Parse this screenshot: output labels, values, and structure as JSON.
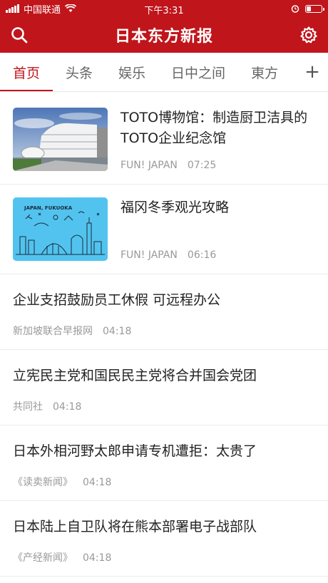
{
  "status": {
    "carrier": "中国联通",
    "time": "下午3:31",
    "battery_level": 0.3
  },
  "header": {
    "title": "日本东方新报",
    "search_icon": "search-icon",
    "settings_icon": "gear-icon"
  },
  "tabs": [
    {
      "label": "首页"
    },
    {
      "label": "头条"
    },
    {
      "label": "娱乐"
    },
    {
      "label": "日中之间"
    },
    {
      "label": "東方"
    }
  ],
  "add_tab_label": "+",
  "feed": [
    {
      "title": "TOTO博物馆：制造厨卫洁具的TOTO企业纪念馆",
      "source": "FUN! JAPAN",
      "time": "07:25"
    },
    {
      "title": "福冈冬季观光攻略",
      "source": "FUN! JAPAN",
      "time": "06:16",
      "thumb_text": "JAPAN, FUKUOKA"
    },
    {
      "title": "企业支招鼓励员工休假 可远程办公",
      "source": "新加坡联合早报网",
      "time": "04:18"
    },
    {
      "title": "立宪民主党和国民民主党将合并国会党团",
      "source": "共同社",
      "time": "04:18"
    },
    {
      "title": "日本外相河野太郎申请专机遭拒：太贵了",
      "source": "《读卖新闻》",
      "time": "04:18"
    },
    {
      "title": "日本陆上自卫队将在熊本部署电子战部队",
      "source": "《产经新闻》",
      "time": "04:18"
    }
  ],
  "colors": {
    "brand": "#c0151b",
    "thumb_blue": "#52c3ef"
  }
}
